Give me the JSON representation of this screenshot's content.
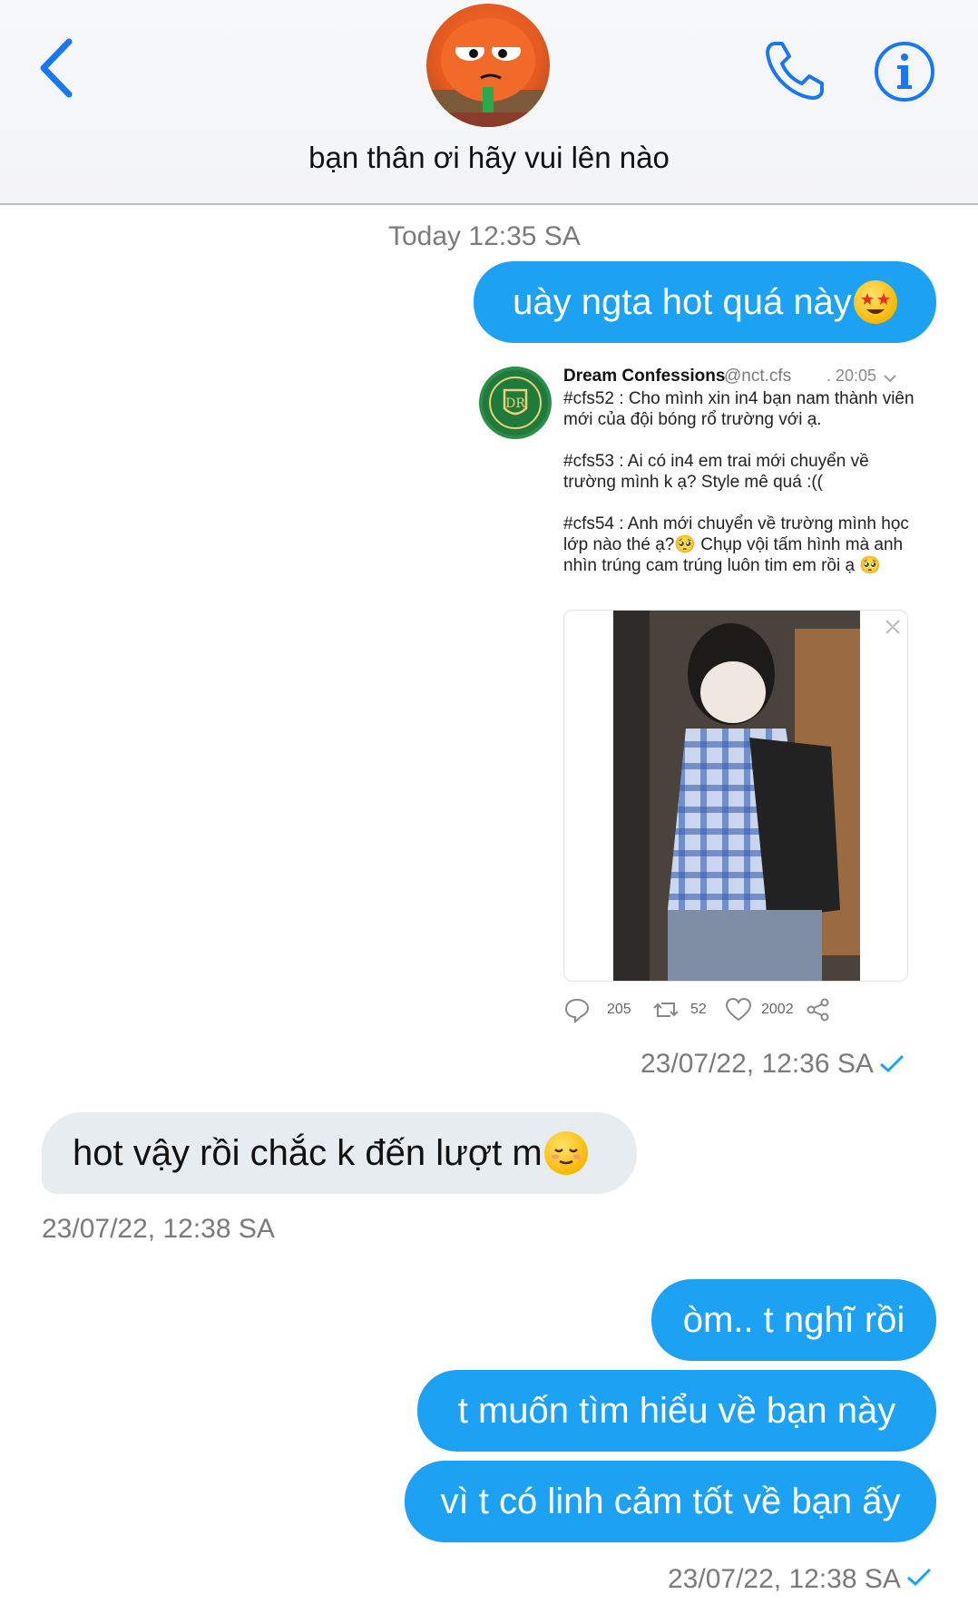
{
  "header": {
    "chat_title": "bạn thân ơi hãy vui lên nào"
  },
  "messages": {
    "day_separator": "Today 12:35 SA",
    "msg1": "uày ngta hot quá này",
    "msg1_emoji": "star-struck-emoji",
    "tweet": {
      "author": "Dream Confessions",
      "handle": "@nct.cfs",
      "time": ". 20:05",
      "text": "#cfs52 : Cho mình xin in4 bạn nam thành viên mới của đội bóng rổ trường với ạ.\n\n#cfs53 : Ai có in4 em trai mới chuyển về trường mình k ạ? Style mê quá :((\n\n#cfs54 : Anh mới chuyển về trường mình học lớp nào thé ạ?🥺 Chụp vội tấm hình mà anh nhìn trúng cam trúng luôn tim em rồi ạ 🥺",
      "replies": "205",
      "retweets": "52",
      "likes": "2002"
    },
    "msg1_status": "23/07/22, 12:36 SA",
    "msg2": "hot vậy rồi chắc k đến lượt m",
    "msg2_emoji": "relieved-emoji",
    "msg2_time": "23/07/22, 12:38 SA",
    "msg3": "òm.. t nghĩ rồi",
    "msg4": "t muốn tìm hiểu về bạn này",
    "msg5": "vì t có linh cảm tốt về bạn ấy",
    "msg5_status": "23/07/22, 12:38 SA"
  },
  "colors": {
    "accent": "#1da1f2",
    "incoming_bubble": "#e6ecf0",
    "timestamp": "#7b7b7b"
  }
}
